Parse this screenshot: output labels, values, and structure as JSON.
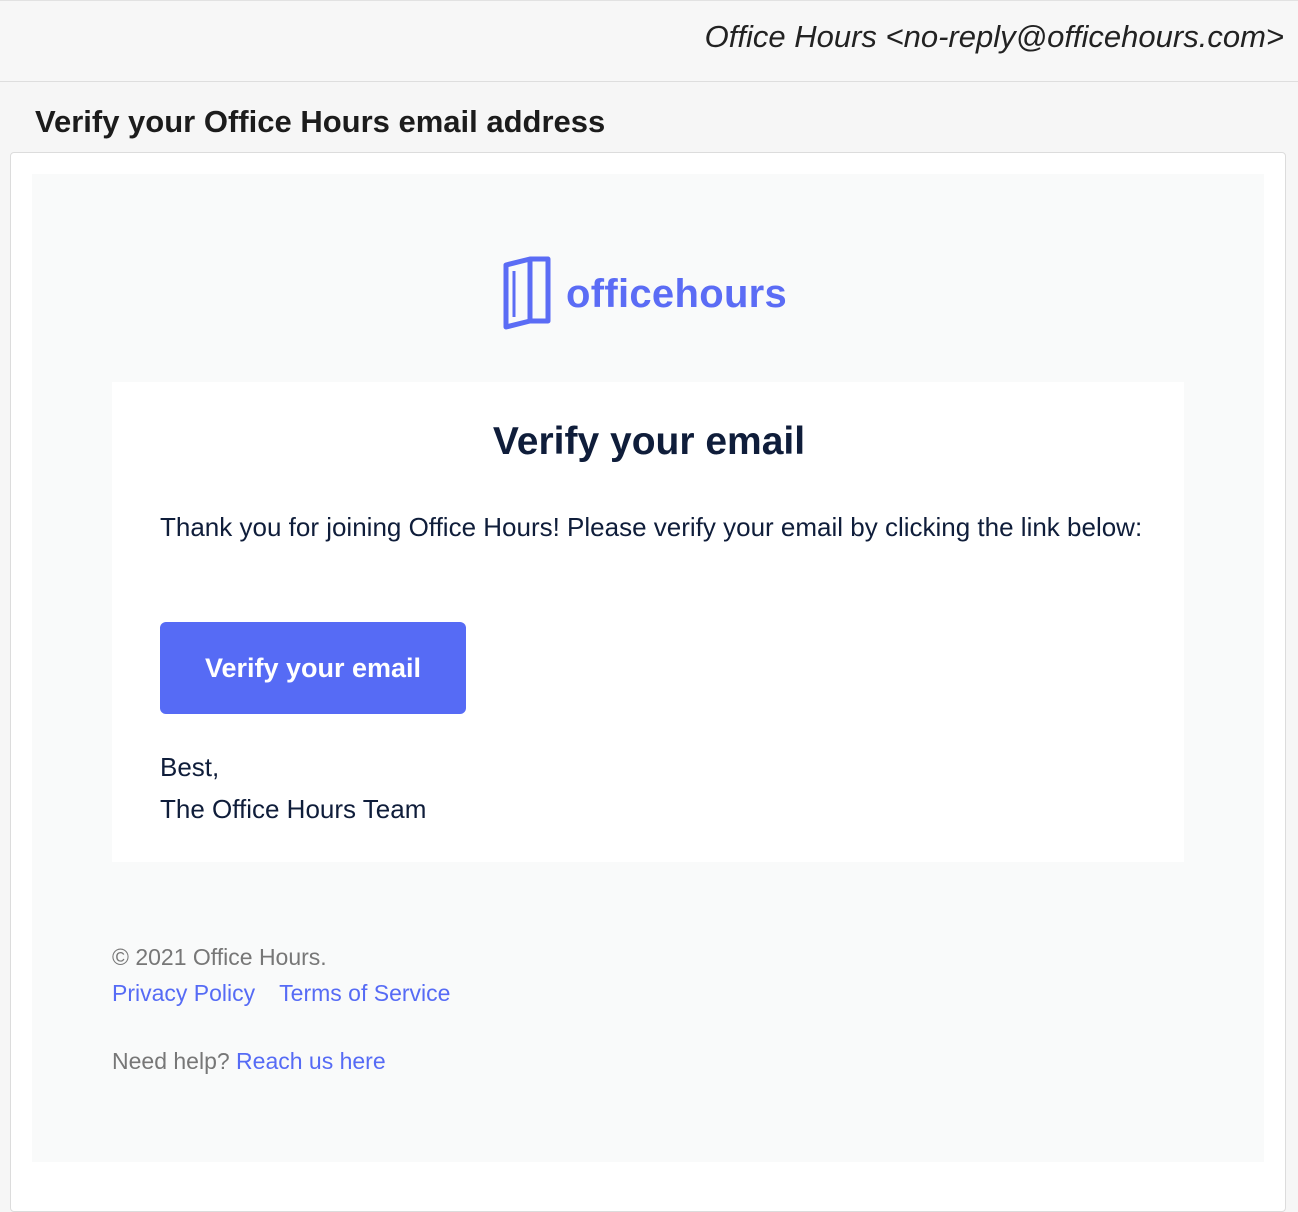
{
  "header": {
    "sender": "Office Hours <no-reply@officehours.com>",
    "subject": "Verify your Office Hours email address"
  },
  "logo": {
    "icon": "book-logo-icon",
    "text": "officehours",
    "color": "#5b6cf5"
  },
  "card": {
    "title": "Verify your email",
    "body": "Thank you for joining Office Hours! Please verify your email by clicking the link below:",
    "button_label": "Verify your email",
    "button_color": "#566bf5",
    "signoff_line1": "Best,",
    "signoff_line2": "The Office Hours Team"
  },
  "footer": {
    "copyright": "© 2021 Office Hours.",
    "privacy_label": "Privacy Policy",
    "terms_label": "Terms of Service",
    "help_prefix": "Need help?",
    "help_link": "Reach us here"
  }
}
